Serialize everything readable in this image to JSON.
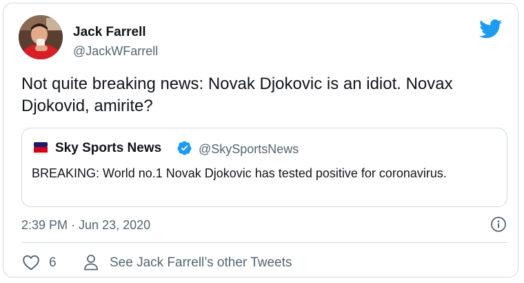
{
  "tweet": {
    "author_name": "Jack Farrell",
    "author_handle": "@JackWFarrell",
    "text": "Not quite breaking news: Novak Djokovic is an idiot. Novax Djokovid, amirite?",
    "timestamp": "2:39 PM · Jun 23, 2020",
    "like_count": "6",
    "other_tweets_label": "See Jack Farrell’s other Tweets"
  },
  "quoted_tweet": {
    "author_name": "Sky Sports News",
    "author_handle": "@SkySportsNews",
    "text": "BREAKING: World no.1 Novak Djokovic has tested positive for coronavirus.",
    "logo_text": "sky sports news"
  },
  "icons": {
    "logo": "twitter-bird-icon",
    "verified": "verified-badge-icon",
    "info": "info-icon",
    "like": "heart-icon",
    "profile": "person-icon"
  },
  "colors": {
    "twitter_blue": "#1d9bf0",
    "text_primary": "#0f1419",
    "text_secondary": "#536471",
    "border": "#cfd9de",
    "sky_red": "#d0021b"
  }
}
